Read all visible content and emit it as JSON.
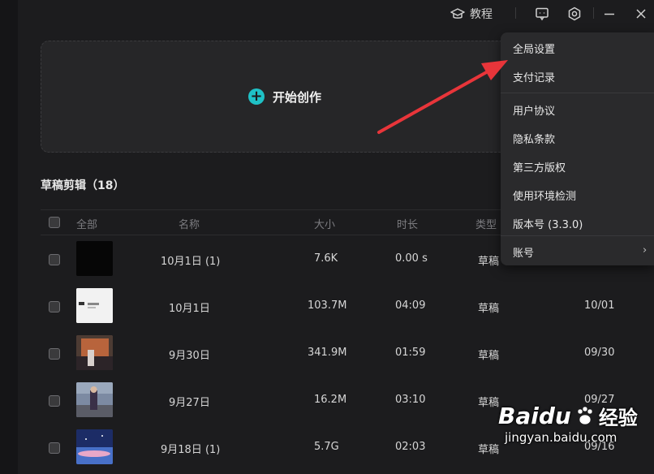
{
  "topbar": {
    "tutorial_label": "教程"
  },
  "create": {
    "label": "开始创作"
  },
  "drafts": {
    "title": "草稿剪辑（18）",
    "columns": {
      "all": "全部",
      "name": "名称",
      "size": "大小",
      "duration": "时长",
      "type": "类型"
    },
    "rows": [
      {
        "name": "10月1日 (1)",
        "size": "7.6K",
        "duration": "0.00 s",
        "type": "草稿",
        "date": ""
      },
      {
        "name": "10月1日",
        "size": "103.7M",
        "duration": "04:09",
        "type": "草稿",
        "date": "10/01"
      },
      {
        "name": "9月30日",
        "size": "341.9M",
        "duration": "01:59",
        "type": "草稿",
        "date": "09/30"
      },
      {
        "name": "9月27日",
        "size": "16.2M",
        "duration": "03:10",
        "type": "草稿",
        "date": "09/27"
      },
      {
        "name": "9月18日 (1)",
        "size": "5.7G",
        "duration": "02:03",
        "type": "草稿",
        "date": "09/16"
      }
    ]
  },
  "menu": {
    "items": [
      "全局设置",
      "支付记录",
      "用户协议",
      "隐私条款",
      "第三方版权",
      "使用环境检测",
      "版本号 (3.3.0)",
      "账号"
    ]
  },
  "watermark": {
    "brand": "Baidu",
    "site_cn": "经验",
    "url": "jingyan.baidu.com"
  },
  "colors": {
    "accent": "#1fc1c6",
    "arrow": "#e8353a",
    "background": "#1c1c1e",
    "menu": "#2a2a2c"
  }
}
